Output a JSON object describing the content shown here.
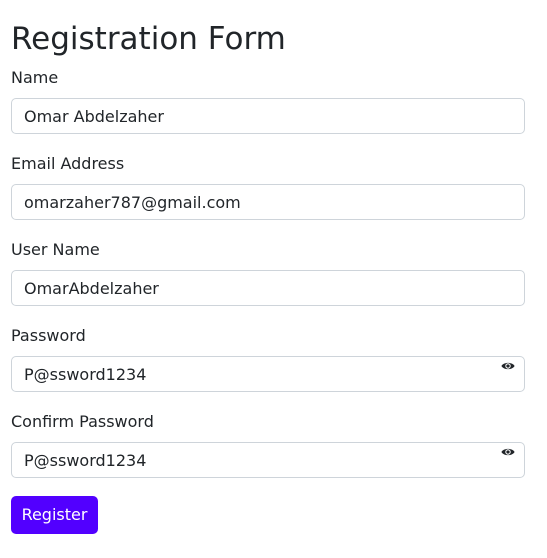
{
  "form": {
    "title": "Registration Form",
    "fields": [
      {
        "label": "Name",
        "value": "Omar Abdelzaher"
      },
      {
        "label": "Email Address",
        "value": "omarzaher787@gmail.com"
      },
      {
        "label": "User Name",
        "value": "OmarAbdelzaher"
      },
      {
        "label": "Password",
        "value": "P@ssword1234",
        "icon": "eye-icon"
      },
      {
        "label": "Confirm Password",
        "value": "P@ssword1234",
        "icon": "eye-icon"
      }
    ],
    "submit_label": "Register"
  },
  "colors": {
    "primary_button": "#5200ff",
    "text": "#212529",
    "input_border": "#ced4da"
  }
}
